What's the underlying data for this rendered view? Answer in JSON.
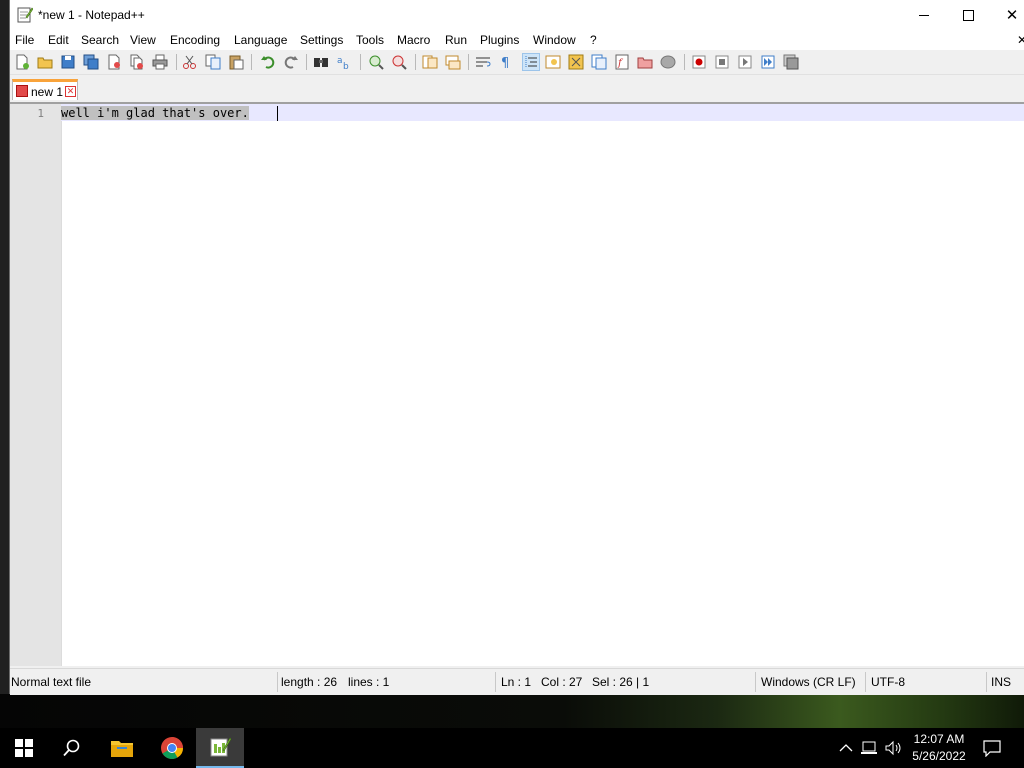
{
  "window": {
    "title": "*new 1 - Notepad++",
    "close_glyph": "✕"
  },
  "menu": {
    "items": [
      "File",
      "Edit",
      "Search",
      "View",
      "Encoding",
      "Language",
      "Settings",
      "Tools",
      "Macro",
      "Run",
      "Plugins",
      "Window",
      "?"
    ],
    "close_glyph": "✕"
  },
  "tabs": [
    {
      "label": "new 1",
      "modified": true,
      "close_glyph": "✕"
    }
  ],
  "editor": {
    "line_numbers": [
      "1"
    ],
    "lines": [
      "well i'm glad that's over."
    ]
  },
  "status": {
    "file_type": "Normal text file",
    "length": "length : 26",
    "lines": "lines : 1",
    "ln": "Ln : 1",
    "col": "Col : 27",
    "sel": "Sel : 26 | 1",
    "eol": "Windows (CR LF)",
    "encoding": "UTF-8",
    "mode": "INS"
  },
  "taskbar": {
    "time": "12:07 AM",
    "date": "5/26/2022",
    "icons": [
      "windows-start-icon",
      "search-icon",
      "file-explorer-icon",
      "chrome-icon",
      "notepad-plus-plus-icon"
    ],
    "tray_icons": [
      "chevron-up-icon",
      "network-icon",
      "volume-icon",
      "notification-icon"
    ]
  },
  "colors": {
    "tab_accent": "#f9a33a",
    "current_line": "#e8e8ff",
    "selection": "#c0c0c0",
    "taskbar_active": "#76b9ed"
  }
}
